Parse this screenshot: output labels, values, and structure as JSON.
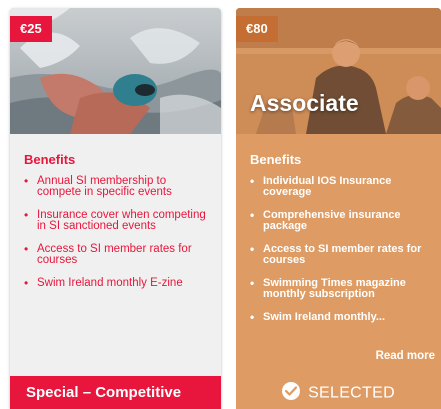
{
  "cards": [
    {
      "price": "€25",
      "tier_name": "",
      "benefits_heading": "Benefits",
      "benefits": [
        "Annual SI membership to compete in specific events",
        "Insurance cover when competing in SI sanctioned events",
        "Access to SI member rates for courses",
        "Swim Ireland monthly E-zine"
      ],
      "footer_label": "Special – Competitive",
      "accent_color": "#e8163c"
    },
    {
      "price": "€80",
      "tier_name": "Associate",
      "benefits_heading": "Benefits",
      "benefits": [
        "Individual IOS Insurance coverage",
        "Comprehensive insurance package",
        "Access to SI member rates for courses",
        "Swimming Times magazine monthly subscription",
        "Swim Ireland monthly..."
      ],
      "read_more": "Read more",
      "footer_label": "SELECTED",
      "footer_icon": "check-circle-icon",
      "accent_color": "#de9b63"
    }
  ]
}
